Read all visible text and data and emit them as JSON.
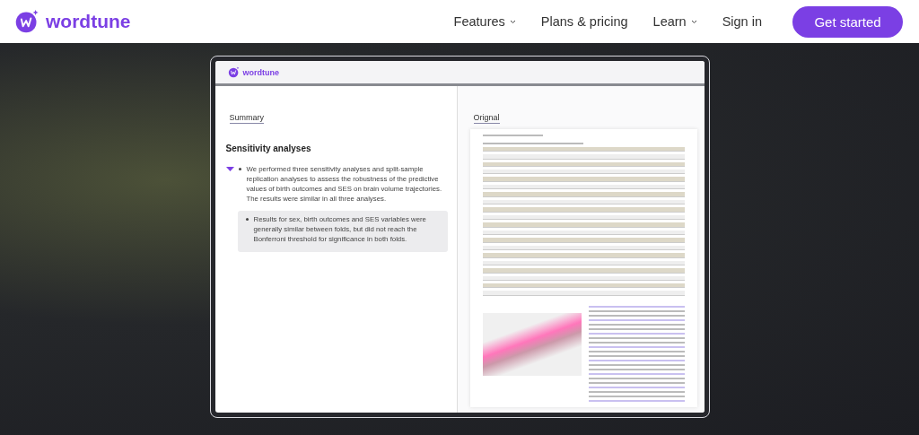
{
  "nav": {
    "logo": "wordtune",
    "links": [
      {
        "label": "Features",
        "dropdown": true
      },
      {
        "label": "Plans & pricing",
        "dropdown": false
      },
      {
        "label": "Learn",
        "dropdown": true
      },
      {
        "label": "Sign in",
        "dropdown": false
      }
    ],
    "cta": "Get started"
  },
  "preview": {
    "logo": "wordtune",
    "summary_tab": "Summary",
    "heading": "Sensitivity analyses",
    "bullets": [
      {
        "text": "We performed three sensitivity analyses and split-sample replication analyses to assess the robustness of the predictive values of birth outcomes and SES on brain volume trajectories. The results were similar in all three analyses.",
        "highlighted": false,
        "marker": true
      },
      {
        "text": "Results for sex, birth outcomes and SES variables were generally similar between folds, but did not reach the Bonferroni threshold for significance in both folds.",
        "highlighted": true,
        "marker": false
      }
    ],
    "original_tab": "Orignal"
  }
}
